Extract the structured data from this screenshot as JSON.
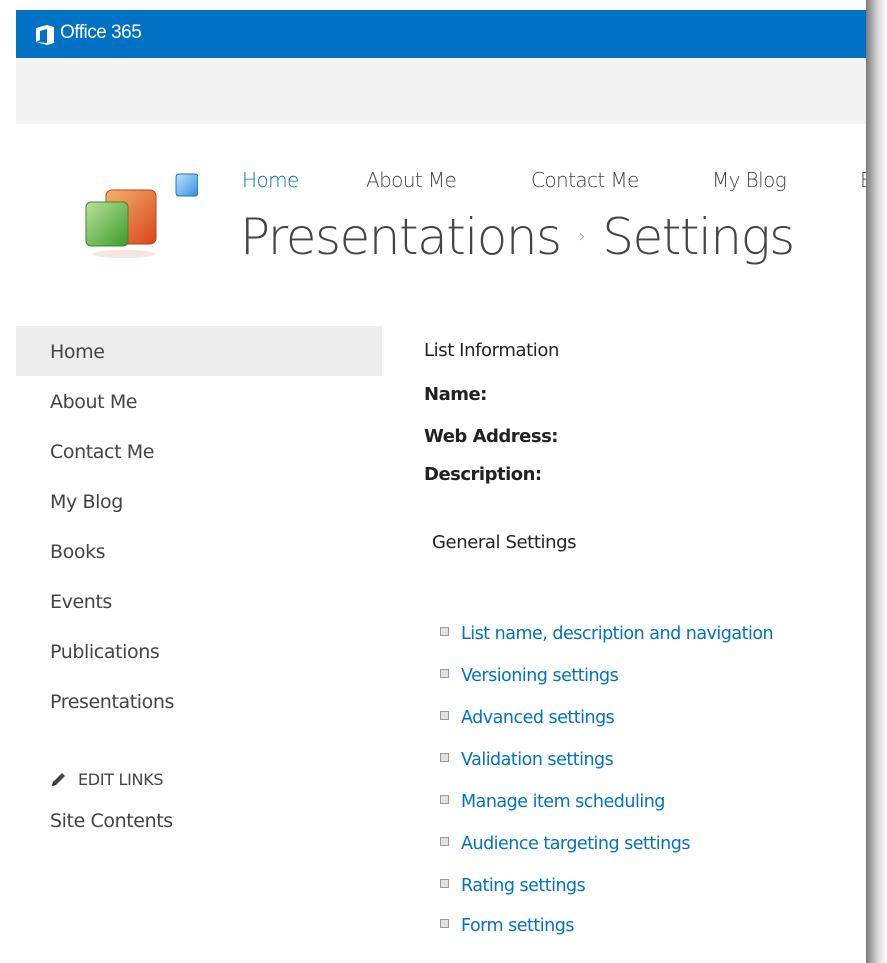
{
  "suite_bar": {
    "title": "Office 365",
    "accent": "#0072c6"
  },
  "top_nav": [
    "Home",
    "About Me",
    "Contact Me",
    "My Blog",
    "Bo"
  ],
  "page_title": {
    "list": "Presentations",
    "separator": "›",
    "page": "Settings"
  },
  "quick_launch": {
    "items": [
      "Home",
      "About Me",
      "Contact Me",
      "My Blog",
      "Books",
      "Events",
      "Publications",
      "Presentations"
    ],
    "selected": "Home",
    "edit_links": "EDIT LINKS",
    "site_contents": "Site Contents"
  },
  "list_information": {
    "heading": "List Information",
    "name_label": "Name:",
    "web_address_label": "Web Address:",
    "description_label": "Description:"
  },
  "general_settings": {
    "heading": "General Settings",
    "links": [
      "List name, description and navigation",
      "Versioning settings",
      "Advanced settings",
      "Validation settings",
      "Manage item scheduling",
      "Audience targeting settings",
      "Rating settings",
      "Form settings"
    ]
  }
}
